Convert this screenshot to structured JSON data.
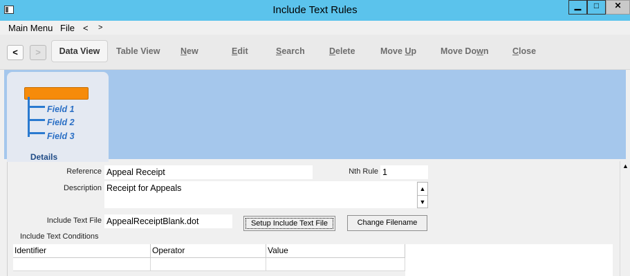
{
  "window": {
    "title": "Include Text Rules",
    "min": "▁",
    "max": "□",
    "close": "✕"
  },
  "menu": {
    "items": [
      "Main Menu",
      "File",
      "<",
      ">"
    ]
  },
  "toolbar": {
    "back": "<",
    "forward": ">",
    "buttons": [
      {
        "pre": "",
        "key": "",
        "post": "Data View"
      },
      {
        "pre": "",
        "key": "",
        "post": "Table View"
      },
      {
        "pre": "",
        "key": "N",
        "post": "ew"
      },
      {
        "pre": "",
        "key": "E",
        "post": "dit"
      },
      {
        "pre": "",
        "key": "S",
        "post": "earch"
      },
      {
        "pre": "",
        "key": "D",
        "post": "elete"
      },
      {
        "pre": "Move ",
        "key": "U",
        "post": "p"
      },
      {
        "pre": "Move Do",
        "key": "w",
        "post": "n"
      },
      {
        "pre": "",
        "key": "C",
        "post": "lose"
      }
    ]
  },
  "tab": {
    "label": "Details",
    "fields": [
      "Field 1",
      "Field 2",
      "Field 3"
    ]
  },
  "form": {
    "reference_label": "Reference",
    "reference_value": "Appeal Receipt",
    "nth_rule_label": "Nth Rule",
    "nth_rule_value": "1",
    "description_label": "Description",
    "description_value": "Receipt for Appeals",
    "include_file_label": "Include Text File",
    "include_file_value": "AppealReceiptBlank.dot",
    "setup_button": "Setup Include Text File",
    "change_button": "Change Filename",
    "conditions_label": "Include Text Conditions"
  },
  "grid": {
    "columns": [
      "Identifier",
      "Operator",
      "Value"
    ]
  }
}
